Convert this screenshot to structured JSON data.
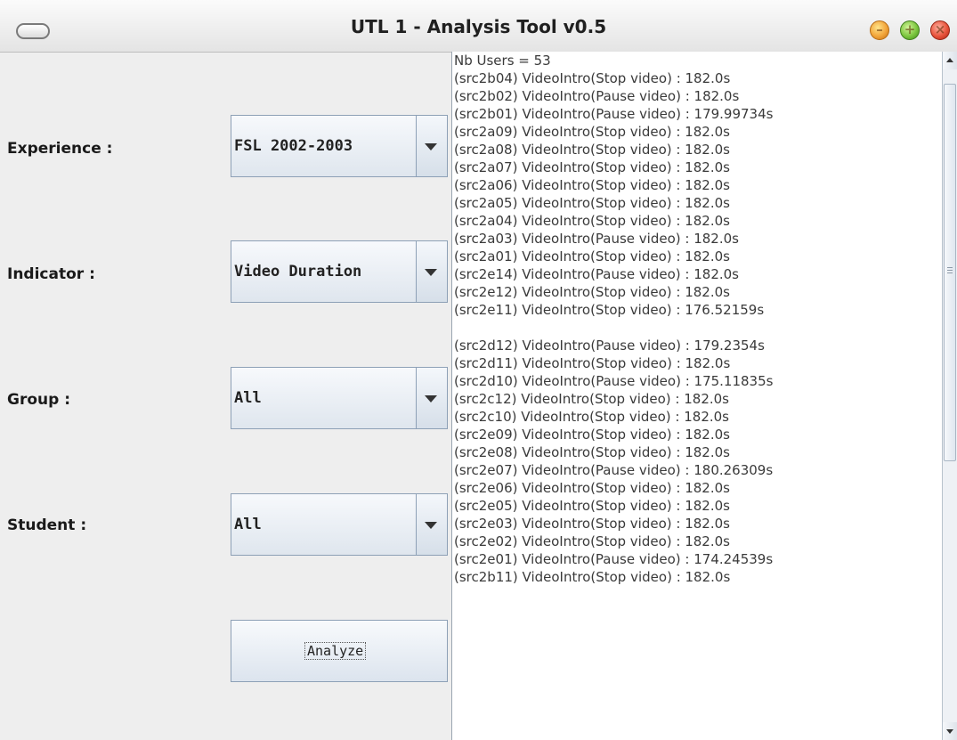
{
  "window": {
    "title": "UTL 1 - Analysis Tool v0.5",
    "controls": {
      "minimize_color": "#f2a53b",
      "maximize_color": "#7cc63f",
      "close_color": "#e8543c"
    }
  },
  "form": {
    "experience_label": "Experience :",
    "experience_value": "FSL 2002-2003",
    "indicator_label": "Indicator :",
    "indicator_value": "Video Duration",
    "group_label": "Group :",
    "group_value": "All",
    "student_label": "Student :",
    "student_value": "All",
    "analyze_label": "Analyze"
  },
  "results": {
    "lines": [
      "Nb Users = 53",
      "(src2b04) VideoIntro(Stop video) : 182.0s",
      "(src2b02) VideoIntro(Pause video) : 182.0s",
      "(src2b01) VideoIntro(Pause video) : 179.99734s",
      "(src2a09) VideoIntro(Stop video) : 182.0s",
      "(src2a08) VideoIntro(Stop video) : 182.0s",
      "(src2a07) VideoIntro(Stop video) : 182.0s",
      "(src2a06) VideoIntro(Stop video) : 182.0s",
      "(src2a05) VideoIntro(Stop video) : 182.0s",
      "(src2a04) VideoIntro(Stop video) : 182.0s",
      "(src2a03) VideoIntro(Pause video) : 182.0s",
      "(src2a01) VideoIntro(Stop video) : 182.0s",
      "(src2e14) VideoIntro(Pause video) : 182.0s",
      "(src2e12) VideoIntro(Stop video) : 182.0s",
      "(src2e11) VideoIntro(Stop video) : 176.52159s",
      "",
      "(src2d12) VideoIntro(Pause video) : 179.2354s",
      "(src2d11) VideoIntro(Stop video) : 182.0s",
      "(src2d10) VideoIntro(Pause video) : 175.11835s",
      "(src2c12) VideoIntro(Stop video) : 182.0s",
      "(src2c10) VideoIntro(Stop video) : 182.0s",
      "(src2e09) VideoIntro(Stop video) : 182.0s",
      "(src2e08) VideoIntro(Stop video) : 182.0s",
      "(src2e07) VideoIntro(Pause video) : 180.26309s",
      "(src2e06) VideoIntro(Stop video) : 182.0s",
      "(src2e05) VideoIntro(Stop video) : 182.0s",
      "(src2e03) VideoIntro(Stop video) : 182.0s",
      "(src2e02) VideoIntro(Stop video) : 182.0s",
      "(src2e01) VideoIntro(Pause video) : 174.24539s",
      "(src2b11) VideoIntro(Stop video) : 182.0s"
    ]
  }
}
